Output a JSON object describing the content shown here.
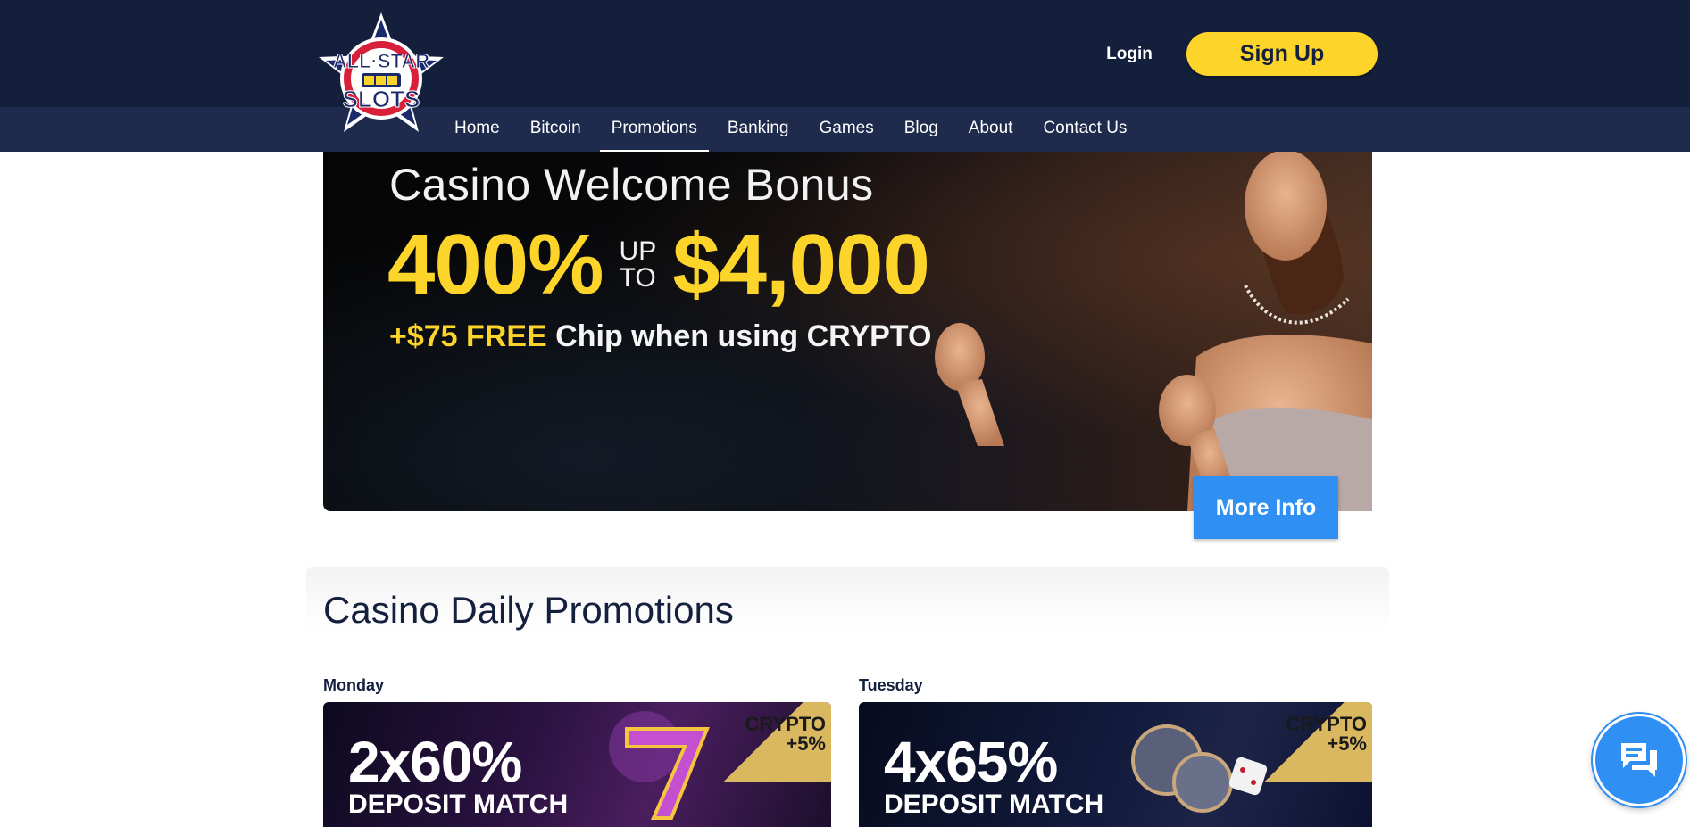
{
  "header": {
    "logo_text": "ALL STAR SLOTS",
    "login_label": "Login",
    "signup_label": "Sign Up"
  },
  "nav": {
    "items": [
      {
        "label": "Home"
      },
      {
        "label": "Bitcoin"
      },
      {
        "label": "Promotions",
        "active": true
      },
      {
        "label": "Banking"
      },
      {
        "label": "Games"
      },
      {
        "label": "Blog"
      },
      {
        "label": "About"
      },
      {
        "label": "Contact Us"
      }
    ]
  },
  "hero": {
    "title": "Casino Welcome Bonus",
    "percent": "400%",
    "up": "UP",
    "to": "TO",
    "amount": "$4,000",
    "sub_highlight": "+$75 FREE",
    "sub_text": "Chip when using CRYPTO",
    "more_info_label": "More Info"
  },
  "daily": {
    "title": "Casino Daily Promotions",
    "cards": [
      {
        "day": "Monday",
        "percent": "2x60%",
        "match": "DEPOSIT MATCH",
        "badge_line1": "CRYPTO",
        "badge_line2": "+5%"
      },
      {
        "day": "Tuesday",
        "percent": "4x65%",
        "match": "DEPOSIT MATCH",
        "badge_line1": "CRYPTO",
        "badge_line2": "+5%"
      }
    ]
  },
  "chat": {
    "icon": "chat-icon"
  },
  "colors": {
    "header_bg": "#141f3c",
    "nav_bg": "#1e2b4d",
    "accent_yellow": "#fdd52a",
    "accent_blue": "#2f8ff2"
  }
}
